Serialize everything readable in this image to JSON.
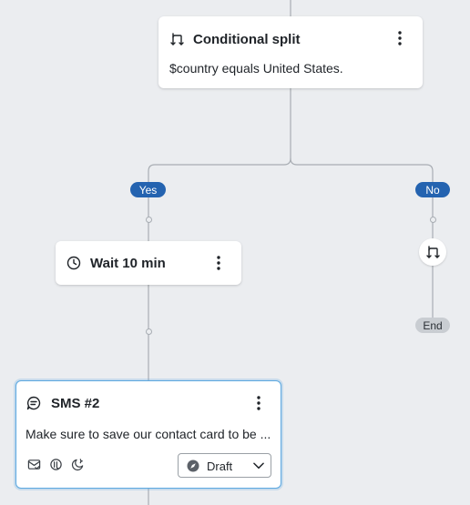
{
  "nodes": {
    "split_top": {
      "title": "Conditional split",
      "condition": "$country equals United States."
    },
    "wait": {
      "title": "Wait 10 min"
    },
    "sms": {
      "title": "SMS #2",
      "body": "Make sure to save our contact card to be ...",
      "status": "Draft"
    }
  },
  "branches": {
    "yes": "Yes",
    "no": "No"
  },
  "end_label": "End",
  "colors": {
    "canvas": "#ebedf0",
    "branch_pill": "#2463b0",
    "end_pill": "#c9cdd2",
    "connector": "#a8adb3",
    "selected_border": "#5aa7e0"
  },
  "icons": {
    "split": "split-arrows-icon",
    "clock": "clock-icon",
    "sms": "chat-bubble-icon",
    "kebab": "more-vertical-icon",
    "status": "compass-icon",
    "chevron": "chevron-down-icon",
    "sms_footer": [
      "envelope-check-icon",
      "link-icon",
      "moon-icon"
    ]
  }
}
